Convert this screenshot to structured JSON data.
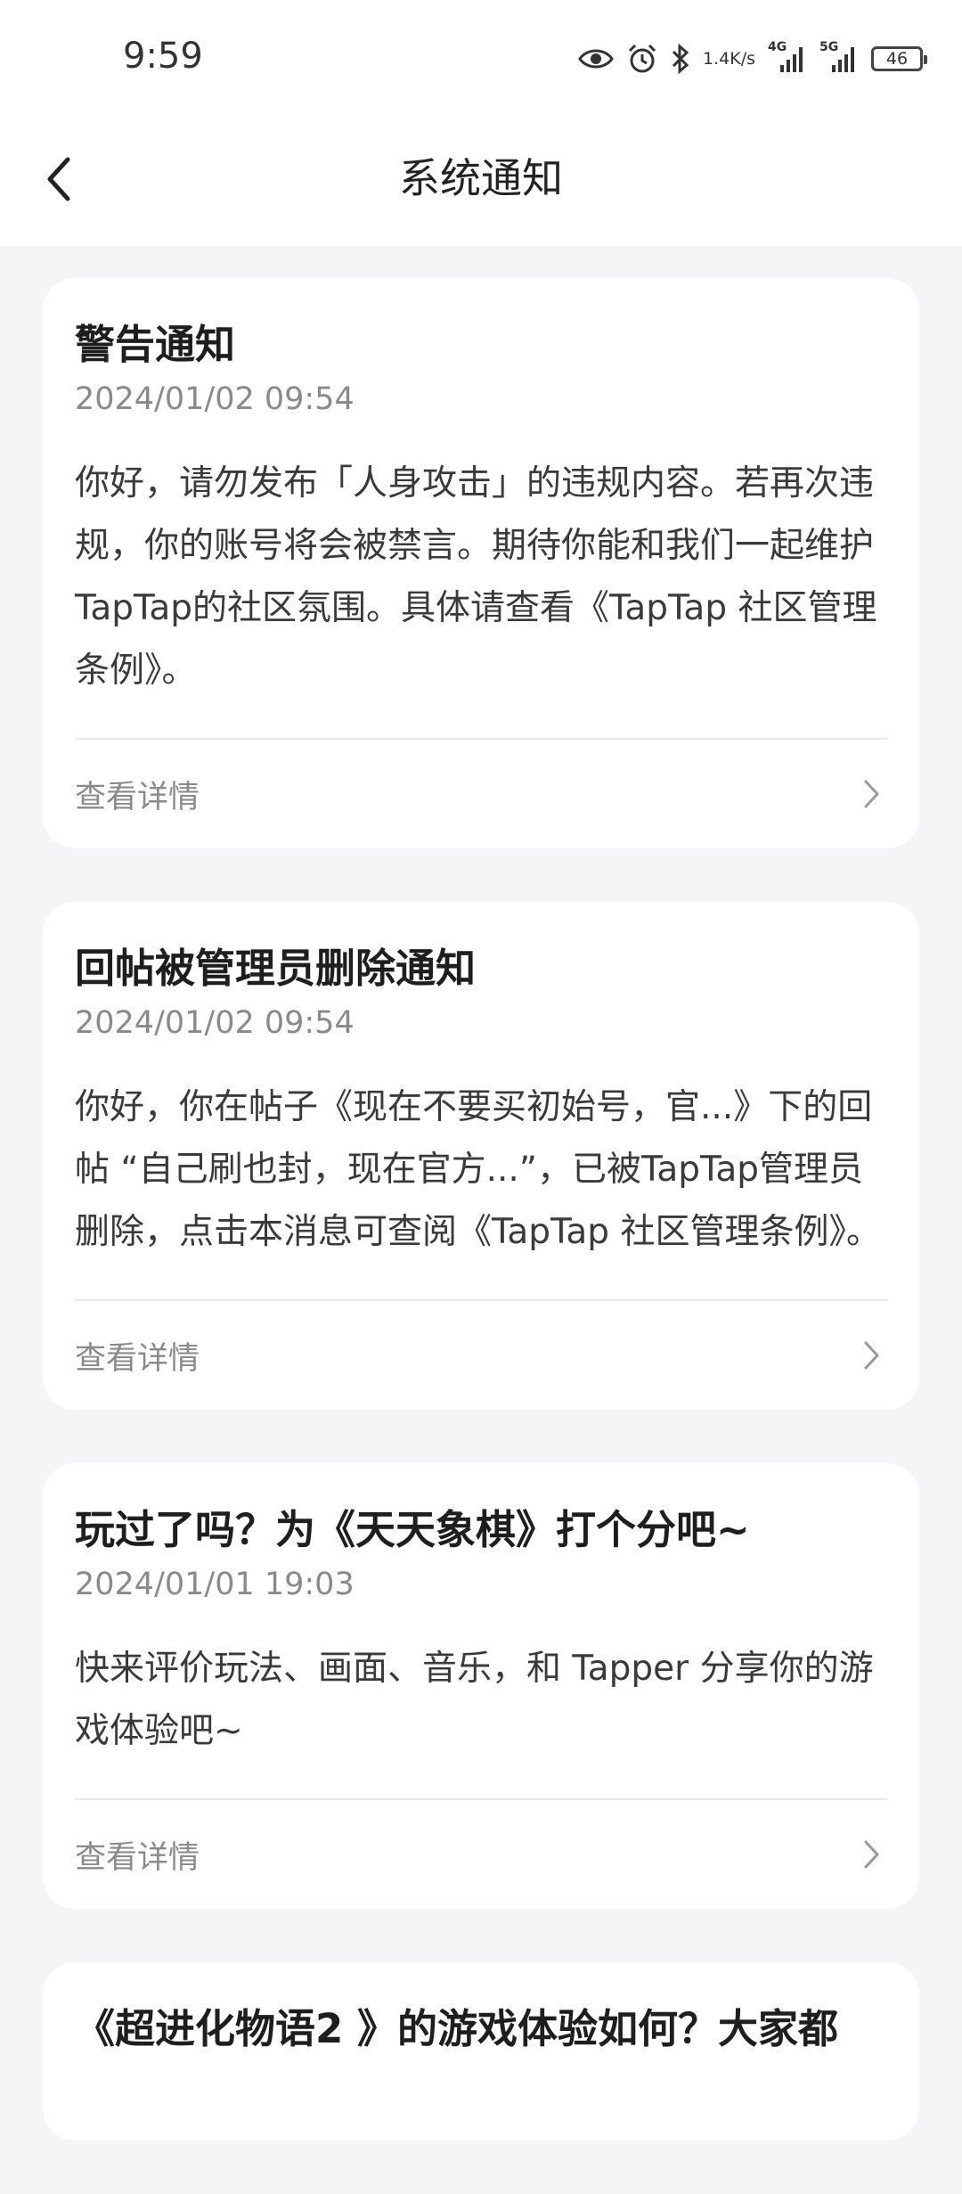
{
  "status_bar": {
    "time": "9:59",
    "net_speed_value": "1.4",
    "net_speed_unit": "K/s",
    "sim1_type": "4G",
    "sim2_type": "5G",
    "battery": "46",
    "icons": [
      "eye-icon",
      "alarm-icon",
      "bluetooth-icon",
      "signal-icon",
      "battery-icon"
    ]
  },
  "header": {
    "title": "系统通知",
    "back_icon": "chevron-left-icon"
  },
  "notifications": [
    {
      "title": "警告通知",
      "time": "2024/01/02 09:54",
      "body": "你好，请勿发布「人身攻击」的违规内容。若再次违规，你的账号将会被禁言。期待你能和我们一起维护TapTap的社区氛围。具体请查看《TapTap 社区管理条例》。",
      "detail_label": "查看详情"
    },
    {
      "title": "回帖被管理员删除通知",
      "time": "2024/01/02 09:54",
      "body": "你好，你在帖子《现在不要买初始号，官...》下的回帖 “自己刷也封，现在官方...”，已被TapTap管理员删除，点击本消息可查阅《TapTap 社区管理条例》。",
      "detail_label": "查看详情"
    },
    {
      "title": "玩过了吗？为《天天象棋》打个分吧~",
      "time": "2024/01/01 19:03",
      "body": "快来评价玩法、画面、音乐，和 Tapper 分享你的游戏体验吧~",
      "detail_label": "查看详情"
    },
    {
      "title": "《超进化物语2 》的游戏体验如何？大家都",
      "time": "",
      "body": "",
      "detail_label": ""
    }
  ],
  "colors": {
    "background": "#f4f5f7",
    "card": "#ffffff",
    "title_text": "#1e1e1e",
    "secondary_text": "#8a8a8a"
  }
}
